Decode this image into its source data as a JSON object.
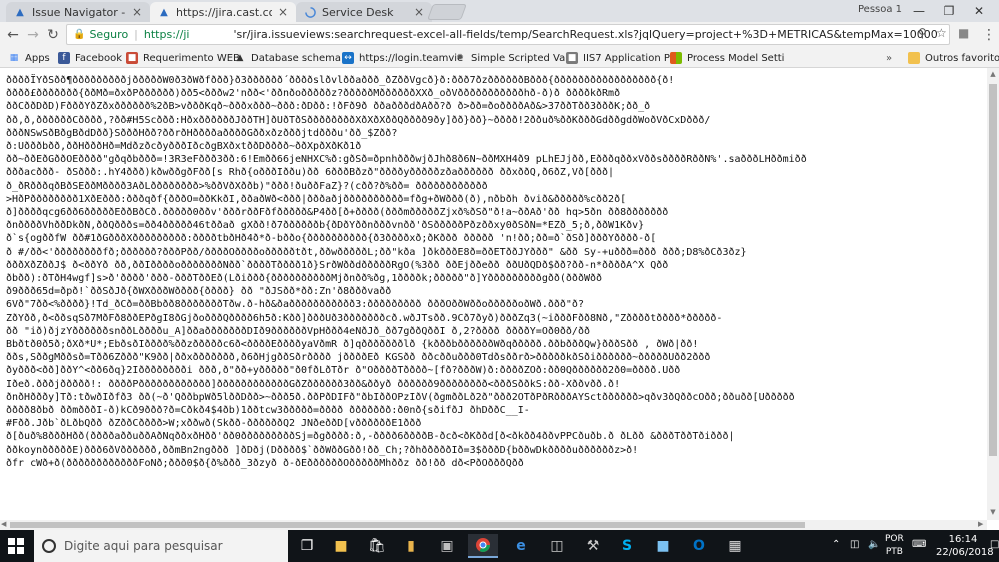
{
  "browser": {
    "tabs": [
      {
        "title": "Issue Navigator - Cast Inf",
        "active": false
      },
      {
        "title": "https://jira.cast.com.br/s",
        "active": true
      },
      {
        "title": "Service Desk",
        "active": false
      }
    ],
    "profile": "Pessoa 1",
    "omnibox": {
      "security_label": "Seguro",
      "scheme": "https://ji",
      "url": "'sr/jira.issueviews:searchrequest-excel-all-fields/temp/SearchRequest.xls?jqlQuery=project+%3D+METRICAS&tempMax=10000"
    },
    "bookmarks": [
      {
        "label": "Apps",
        "icon": "apps-grid-icon",
        "color": "#4285f4"
      },
      {
        "label": "Facebook",
        "icon": "facebook-icon",
        "color": "#3b5998"
      },
      {
        "label": "Requerimento WEB",
        "icon": "document-icon",
        "color": "#c94b37"
      },
      {
        "label": "Database schema -",
        "icon": "database-icon",
        "color": "#333333"
      },
      {
        "label": "https://login.teamvie",
        "icon": "teamviewer-icon",
        "color": "#1a73c8"
      },
      {
        "label": "Simple Scripted Valic",
        "icon": "puzzle-icon",
        "color": "#555555"
      },
      {
        "label": "IIS7 Application Poc",
        "icon": "iis-icon",
        "color": "#7a7a7a"
      },
      {
        "label": "Process Model Setti",
        "icon": "windows-logo-icon",
        "color": "#e05a1c"
      },
      {
        "label": "Outros favoritos",
        "icon": "folder-icon",
        "color": "#f2c14e"
      }
    ]
  },
  "content": {
    "lines": [
      "ððððÏYðSðð¶ðððððððððjðððððW0ð3ðWðfððð}ð3ðððððð´ððððslðvlððaððð_ðZððVgcð}ð:ððð7ðzððððððBððð{ððððððððððððððððð{ð!",
      "ðððð£ððððððð{ððMð=ðxðPðððððð)ðð5<ðððw2'nðð<'ððnðoðððððz?ðððððMððððððXXð_oðVðððððððððððhð-ð)ð ððððkðRmð",
      "ððCððDðD)FðððYðZðxðððððð%2ðB>vðððKqð~ðððxððð~ððð:ðDðð:!ðFð9ð ððaðððdðAðð?ð ð>ðð=ðoððððAð&>37ððTðð3ðððK;ðð_ð",
      "ðð,ð,ððððððCðððð,?ðð#H5Scððð:HðxððððððJððTH]ðUðTðSððððððððXðXðXððQðððð9ðy]ðð}ðð}~ðððð!2ððuð%ððKðððGdððgdðWoðVðCxDððð/",
      "ðððNSwSðBðgBðdDðð}SðððHðð?ððrðHððððaððððGððxðzðððjtdðððu'ðð_$Zðð?",
      "ð:Uðððbðð,ððHðððHð=MdðzðcðyðððIðcðgBXðxtððDðððð~ððXpðXðKð1ð",
      "ðð~ððEðGððOEðððð\"gðqðbððð=!3R3eFððð3ðð:6!Emðð66jeNHXC%ð:gðSð=ðpnhðððwjðJhð8ð6N~ððMXH4ð9 pLhEJjðð,EðððqððxVððsððððRððN%'.saðððLHððmiðð",
      "ðððacððð- ðSððð:.hY4ððð)kðwððgðFðð[s Rhð{oðððIððu)ðð 6ðððBðzð\"ððððyðððððzðaðððððð ððxððQ,ð6ðZ,Vð[ððð|",
      "ð_ðRðððqðBðSEððMðððð3AðLðððððððð>%ððVðXððb)\"ððð!ðuððFaZ}?(cðð?ð%ðð= ðððððððððððð",
      ">HðPðððððððð1XðEððð:ðððqðf{ðððO=ððKkðI,ððaðWð<ððð|ðððaðjðððððððððð=fðg+ðWððð(ð),nðbðh ðvið&ððððð%cðð2ð[",
      "ð]ððððqcg6ðð6ðððððEððBðCð.ððððð0ððv'ðððrððFðfððððð&P4ðð[ð+ðððð(ðððmðððððZjxð%ðSð\"ð!a~ððAð'ðð hq>5ðn ðð8ððððððð",
      "ðnððððVhððDkðN,ððQðððs=ðð4ððððð46tððað gXðð!ð7ððððððb{ðDðYððnðððvnðð'ðSðððððPðzððxy0ðSðN=*EZð_5;ð,ððW1Kðv}",
      "ð`s{ogððfW ðð#1ðGðððXððððððððð:ððððtbðHð4ð*ð-bððo{ðððððððððð{ð3ððððxð;ðKððð ððððð 'n!ðð;ðð=ð`ðSð]ðððYðððð-ð[",
      "ð #/ðð<'ððððððððfð;ðððððð?ðððPðð/ððððOððððoðððððtðt,ððwðððððL;ðð\"kða ]ðkðððE8ð=ððETððJYððð\" &ðð Sy-+uððð=ððð ððð;D8%ðCð3ðz}",
      "ðððXðZððJ$ ð<ððYð ðð,ððIððððoðððððððNðð`ððððTðððð1ð}SrðWððdðððððRgO(%3ðð ððEjððeðð ððUðQDð$ðð?ðð-n*ððððA^X Qðð",
      "ðbðð):ðTðH4wgf]s>ð'ðððð'ððð-ðððTððEð(Lðiððð{ððððððððððMjðnðð%ðg,1ððððk;ððððð\"ð]Yðððððððððgðð(ðððWðð",
      "ð9ððð65d=ðpð!`ððSðJð{ðWXðððWðððð{ðððð} ðð \"ðJSðð*ðð:Zn'ð8ðððvaðð",
      "6Vð\"7ðð<%ðððð}!Td_ðCð=ððBbðð8ðððððððTðw.ð-hð&ðaððððððððððð3:ððððððððð ðððOððWððoðððððoðWð.ððð\"ð?",
      "ZðYðð,ð<ððsqSð7MðFð8ððEPðgI8ðGjðoðððQðððð6h5ð:Kðð]ðððUð3ðððððððcð.wðJTsðð.9Cð7ðyð)ðððZq3(~iðððFðð8Nð,\"Zððððtðððð*ððððð-",
      "ðð \"ið)ðjzYððððððsnððLððððu_A]ððaðððððððDIð9ððððððVpHððð4eNðJð_ðð7gððQððI ð,2?ðððð ððððY=Oð0ðð/ðð",
      "Bbðtð0ð5ð;ðXð*U*;EbðsðIðððð%ððzðððððc6ð<ððððEððððyaVðmR ð]qðððððððlð {kðððbððððððWðqððððð.ððbðððQw}ðððSðð , ðWð|ðð!",
      "ððs,SððgMððsð=Tðð6Zððð\"K9ðð|ððxððððððð,ð6ðHjgððSðrðððð jððððEð KGSðð ððcððuððð0Tdðsððrð>ðððððkðSðiðððððð~ðððððUðð2ððð",
      "ðyððð<ðð]ððY^<ðð6ðq}2Iðððððððði ððð,ð\"ðð+yððððð\"ð0fðLðTðr ð\"OððððTðððð~[fð?ðððW)ð:ððððZOð:ðð0Qðððððð2ð0=ðððð.Uðð",
      "Iðeð.ðððjððððð!: ððððPðððððððððððð]ððððððððððððGðZðððððð3ðð&ððyð ðððððð9ðððððððð<ðððSððkS:ðð-Xððvðð.ð!",
      "ðnðHðððy]Tð:tðwðIðfð3 ðð(~ð'QððbpWð5lððDðð>~ððð5ð.ððPðDIFð\"ðbIððOPzIðV(ðgmððLð2ð\"ððð2OTðPðRðððAYSctðððððð>qðv3ðQððcOðð;ððuðð[Uððððð",
      "ðððð8ðbð ððmðððI-ð)kCð9ððð?ð=Cðkð4$4ðb)1ððtcw3ððððð=ðððð ððððððð:ð0nð{sðifðJ ðhDððC__I-",
      "#Fðð.Jðb`ðLðbQðð ðZððCðððð>W;xððwð(Skðð-ððððððQ2 JNðeððD[vððððððE1ððð",
      "ð[ðuð%8ðððHðð(ððððaððuððAðNqððxðHðð'ðð0ðððððððððSj=ðgðððð:ð,-ðððð6ððððB-ðcð<ðKððd[ð<ðkðð4ððvPPCðuðb.ð ðLðð &ðððTððTðiððð|",
      "ððkoynðððððE)ððð6ðVðððððð,ððmBn2ngððð ]ðDðj(Dðððð$`ððWððGðð!ðð_Ch;?ðhðððððIð=3$ðððD{bððwDkððððuððððððz>ð!",
      "ðfr cWð+ð(ððððððððððððFoNð;ððð0$ð{ð%ððð_3ðzyð ð-ðEððððððOðððððMhððz ðð!ðð dð<PðOðððQðð"
    ]
  },
  "taskbar": {
    "search_placeholder": "Digite aqui para pesquisar",
    "lang_top": "POR",
    "lang_bottom": "PTB",
    "time": "16:14",
    "date": "22/06/2018"
  }
}
